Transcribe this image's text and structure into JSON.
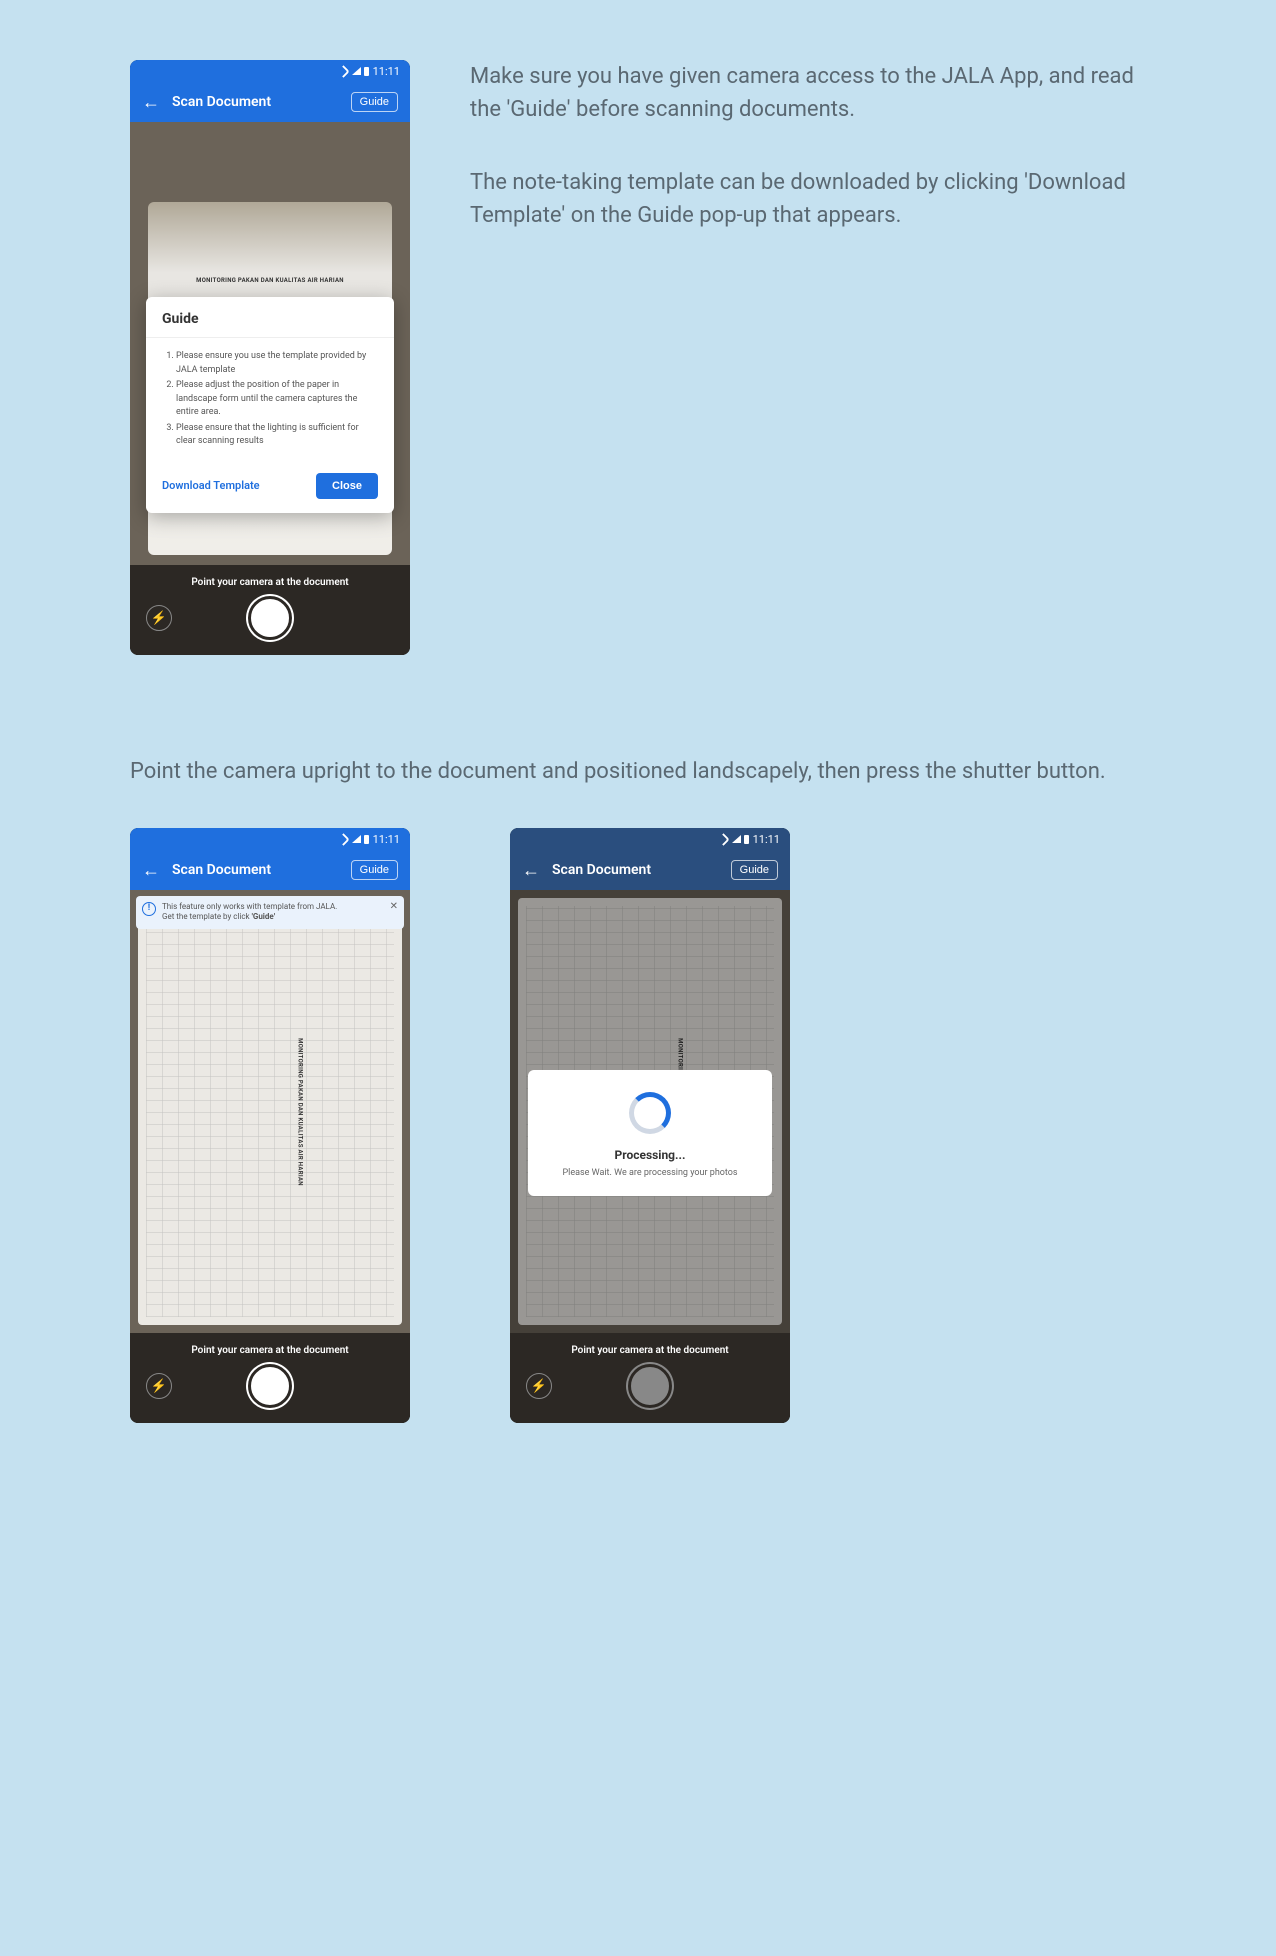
{
  "status_time": "11:11",
  "app": {
    "title": "Scan Document",
    "guide_button": "Guide"
  },
  "doc_title": "MONITORING PAKAN DAN KUALITAS AIR HARIAN",
  "guide_modal": {
    "title": "Guide",
    "items": [
      "Please ensure you use the template provided by JALA template",
      "Please adjust the position of the paper in landscape form until the camera captures the entire area.",
      "Please ensure that the lighting is sufficient for clear scanning results"
    ],
    "download": "Download Template",
    "close": "Close"
  },
  "bottom_text": "Point your camera at the document",
  "side": {
    "p1": "Make sure you have given camera access to the JALA App, and read the 'Guide' before scanning documents.",
    "p2": "The note-taking template can be downloaded by clicking 'Download Template' on the Guide pop-up that appears."
  },
  "row2_text": "Point the camera upright to the document and positioned landscapely, then press the shutter button.",
  "info_banner": {
    "line1": "This feature only works with template from JALA.",
    "line2_prefix": "Get the template by click ",
    "line2_bold": "'Guide'"
  },
  "processing": {
    "title": "Processing...",
    "sub": "Please Wait. We are processing your photos"
  }
}
